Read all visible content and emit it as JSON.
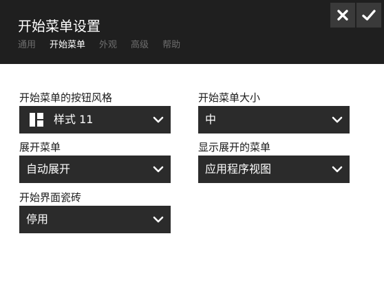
{
  "header": {
    "title": "开始菜单设置",
    "tabs": [
      {
        "label": "通用",
        "active": false
      },
      {
        "label": "开始菜单",
        "active": true
      },
      {
        "label": "外观",
        "active": false
      },
      {
        "label": "高级",
        "active": false
      },
      {
        "label": "帮助",
        "active": false
      }
    ],
    "close_icon": "close-icon",
    "confirm_icon": "checkmark-icon"
  },
  "fields": {
    "button_style": {
      "label": "开始菜单的按钮风格",
      "value": "样式 11",
      "icon": "layout-tiles-icon"
    },
    "menu_size": {
      "label": "开始菜单大小",
      "value": "中"
    },
    "expand_menu": {
      "label": "展开菜单",
      "value": "自动展开"
    },
    "show_expanded": {
      "label": "显示展开的菜单",
      "value": "应用程序视图"
    },
    "start_tiles": {
      "label": "开始界面瓷砖",
      "value": "停用"
    }
  },
  "colors": {
    "header_bg": "#1f1f1f",
    "header_button_bg": "#3a3a3a",
    "select_bg": "#2b2b2b",
    "active_tab": "#ffffff",
    "inactive_tab": "#6e6e6e"
  }
}
